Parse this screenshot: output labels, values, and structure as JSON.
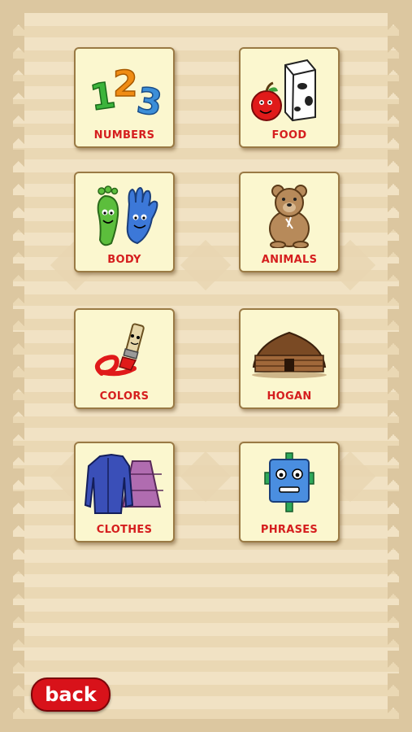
{
  "categories": [
    {
      "label": "NUMBERS",
      "icon": "numbers-123-icon"
    },
    {
      "label": "FOOD",
      "icon": "apple-milk-icon"
    },
    {
      "label": "BODY",
      "icon": "foot-hand-icon"
    },
    {
      "label": "ANIMALS",
      "icon": "bear-icon"
    },
    {
      "label": "COLORS",
      "icon": "paintbrush-icon"
    },
    {
      "label": "HOGAN",
      "icon": "hogan-icon"
    },
    {
      "label": "CLOTHES",
      "icon": "shirt-skirt-icon"
    },
    {
      "label": "PHRASES",
      "icon": "robot-icon"
    }
  ],
  "back_label": "back",
  "colors": {
    "label": "#d51e1e",
    "back_button": "#d8121a",
    "tile": "#fbf7cf"
  }
}
